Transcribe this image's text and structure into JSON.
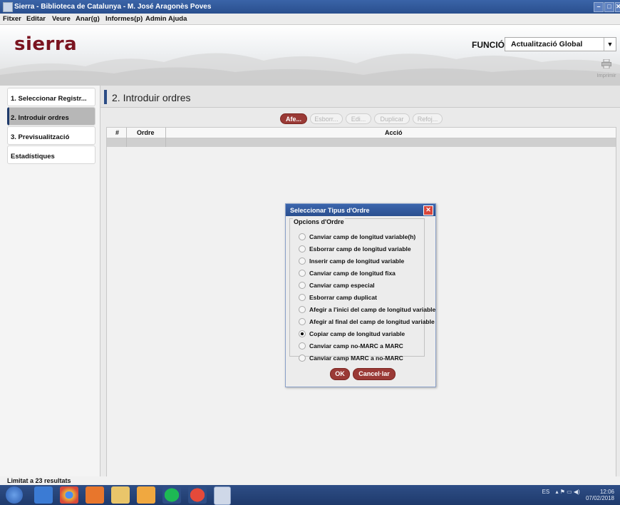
{
  "window": {
    "title": "Sierra - Biblioteca de Catalunya - M. José Aragonès Poves",
    "buttons": [
      "–",
      "□",
      "✕"
    ]
  },
  "menu": [
    "Fitxer",
    "Editar",
    "Veure",
    "Anar(g)",
    "Informes(p)",
    "Admin",
    "Ajuda"
  ],
  "header": {
    "logo": "sierra",
    "funcio_label": "FUNCIÓ",
    "funcio_value": "Actualització Global",
    "print_label": "Imprimir"
  },
  "nav": [
    {
      "label": "1. Seleccionar Registr..."
    },
    {
      "label": "2. Introduir ordres"
    },
    {
      "label": "3. Previsualització"
    },
    {
      "label": "Estadístiques"
    }
  ],
  "main": {
    "title": "2. Introduir ordres",
    "toolbar": [
      "Afe...",
      "Esborr...",
      "Edi...",
      "Duplicar",
      "Refoj..."
    ],
    "columns": [
      "#",
      "Ordre",
      "Acció"
    ]
  },
  "status": "Limitat a 23 resultats",
  "dialog": {
    "title": "Seleccionar Tipus d'Ordre",
    "group": "Opcions d'Ordre",
    "options": [
      "Canviar camp de longitud variable(h)",
      "Esborrar camp de longitud variable",
      "Inserir camp de longitud variable",
      "Canviar camp de longitud fixa",
      "Canviar camp especial",
      "Esborrar camp duplicat",
      "Afegir a l'inici del camp de longitud variable",
      "Afegir al final del camp de longitud variable",
      "Copiar camp de longitud variable",
      "Canviar camp no-MARC a MARC",
      "Canviar camp MARC a no-MARC"
    ],
    "selected_index": 8,
    "ok": "OK",
    "cancel": "Cancel·lar"
  },
  "taskbar": {
    "lang": "ES",
    "time": "12:06",
    "date": "07/02/2018"
  }
}
